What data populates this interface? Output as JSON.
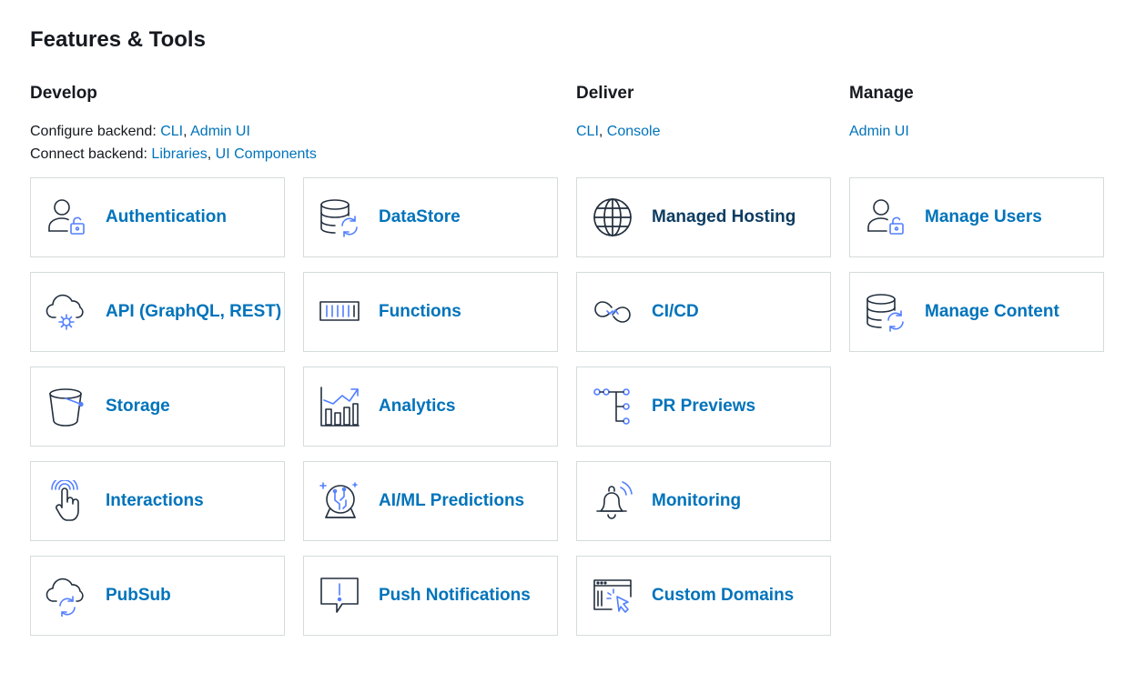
{
  "page_title": "Features & Tools",
  "develop": {
    "heading": "Develop",
    "configure": {
      "prefix": "Configure backend: ",
      "links": [
        "CLI",
        "Admin UI"
      ]
    },
    "connect": {
      "prefix": "Connect backend: ",
      "links": [
        "Libraries",
        "UI Components"
      ]
    },
    "separator": ", ",
    "cards": [
      {
        "label": "Authentication",
        "icon": "user-lock-icon"
      },
      {
        "label": "DataStore",
        "icon": "database-sync-icon"
      },
      {
        "label": "API (GraphQL, REST)",
        "icon": "cloud-gear-icon"
      },
      {
        "label": "Functions",
        "icon": "function-bars-icon"
      },
      {
        "label": "Storage",
        "icon": "bucket-icon"
      },
      {
        "label": "Analytics",
        "icon": "bar-chart-trend-icon"
      },
      {
        "label": "Interactions",
        "icon": "touch-hand-icon"
      },
      {
        "label": "AI/ML Predictions",
        "icon": "crystal-ball-icon"
      },
      {
        "label": "PubSub",
        "icon": "cloud-sync-icon"
      },
      {
        "label": "Push Notifications",
        "icon": "message-alert-icon"
      }
    ]
  },
  "deliver": {
    "heading": "Deliver",
    "links": [
      "CLI",
      "Console"
    ],
    "separator": ", ",
    "cards": [
      {
        "label": "Managed Hosting",
        "icon": "globe-icon"
      },
      {
        "label": "CI/CD",
        "icon": "infinity-loop-icon"
      },
      {
        "label": "PR Previews",
        "icon": "branch-tree-icon"
      },
      {
        "label": "Monitoring",
        "icon": "bell-signal-icon"
      },
      {
        "label": "Custom Domains",
        "icon": "browser-cursor-icon"
      }
    ]
  },
  "manage": {
    "heading": "Manage",
    "links": [
      "Admin UI"
    ],
    "cards": [
      {
        "label": "Manage Users",
        "icon": "user-lock-icon"
      },
      {
        "label": "Manage Content",
        "icon": "database-sync-icon"
      }
    ]
  },
  "colors": {
    "link": "#0073bb",
    "hosting_label": "#0d3c61",
    "icon_stroke": "#232f3e",
    "icon_accent": "#527fff",
    "border": "#d5dbdb"
  }
}
